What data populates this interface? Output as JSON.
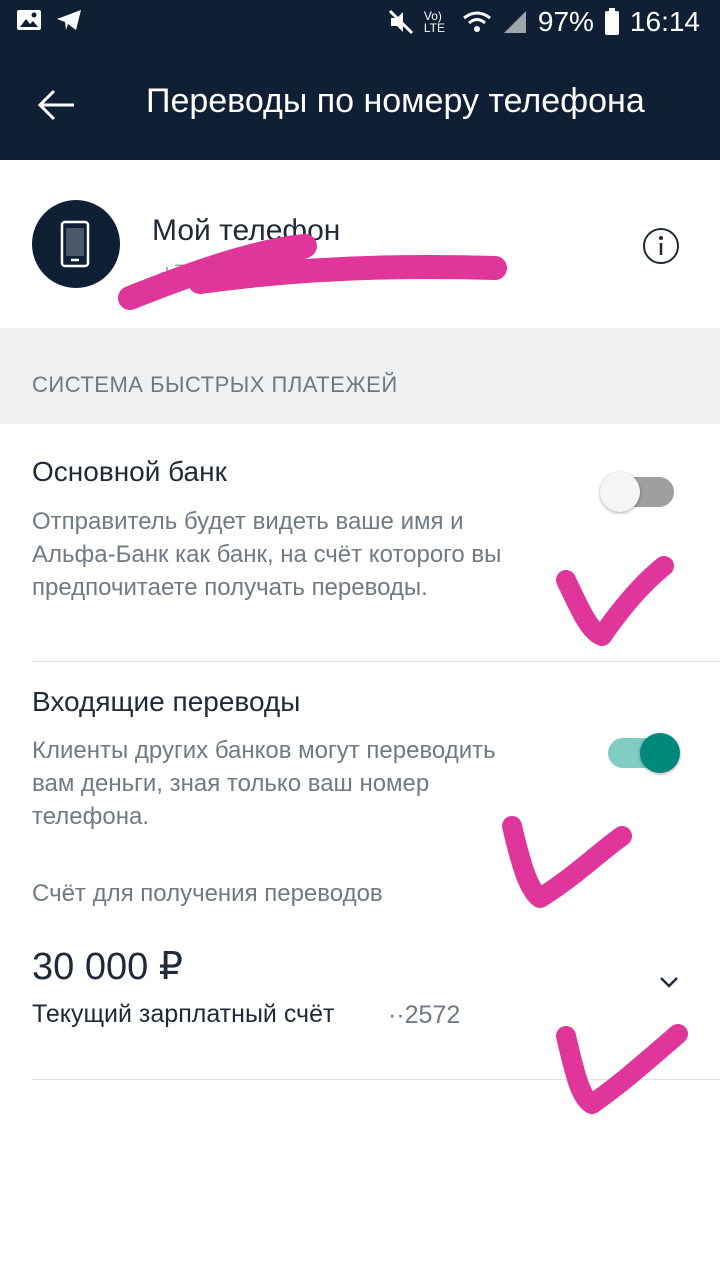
{
  "status_bar": {
    "battery": "97%",
    "time": "16:14",
    "network": "Vo) LTE"
  },
  "header": {
    "title": "Переводы по номеру телефона"
  },
  "phone_card": {
    "title": "Мой телефон",
    "number": "+7"
  },
  "section": {
    "title": "СИСТЕМА БЫСТРЫХ ПЛАТЕЖЕЙ"
  },
  "main_bank": {
    "title": "Основной банк",
    "description": "Отправитель будет видеть ваше имя и Альфа-Банк как банк, на счёт которого вы предпочитаете получать переводы.",
    "enabled": false
  },
  "incoming": {
    "title": "Входящие переводы",
    "description": "Клиенты других банков могут переводить вам деньги, зная только ваш номер телефона.",
    "enabled": true
  },
  "account": {
    "label": "Счёт для получения переводов",
    "amount": "30 000 ₽",
    "name": "Текущий зарплатный счёт",
    "number": "··2572"
  },
  "colors": {
    "header_bg": "#0f2034",
    "accent": "#00897b",
    "annotation": "#e0359a"
  }
}
